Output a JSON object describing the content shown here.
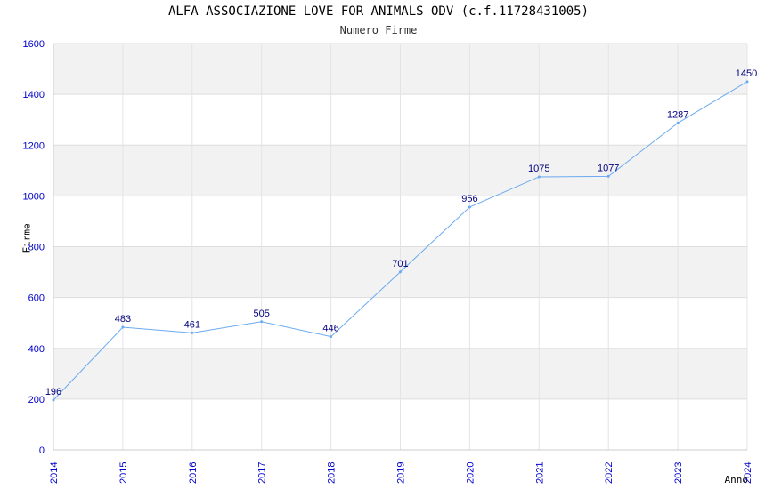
{
  "chart_data": {
    "type": "line",
    "title": "ALFA ASSOCIAZIONE LOVE FOR ANIMALS ODV (c.f.11728431005)",
    "subtitle": "Numero Firme",
    "xlabel": "Anno",
    "ylabel": "Firme",
    "categories": [
      "2014",
      "2015",
      "2016",
      "2017",
      "2018",
      "2019",
      "2020",
      "2021",
      "2022",
      "2023",
      "2024"
    ],
    "values": [
      196,
      483,
      461,
      505,
      446,
      701,
      956,
      1075,
      1077,
      1287,
      1450
    ],
    "ylim": [
      0,
      1600
    ],
    "yticks": [
      "0",
      "200",
      "400",
      "600",
      "800",
      "1000",
      "1200",
      "1400",
      "1600"
    ],
    "grid": true,
    "colors": {
      "line": "#6aaaf0",
      "band": "#f2f2f2",
      "tick_text": "#0000cc",
      "data_label": "#000080"
    }
  }
}
